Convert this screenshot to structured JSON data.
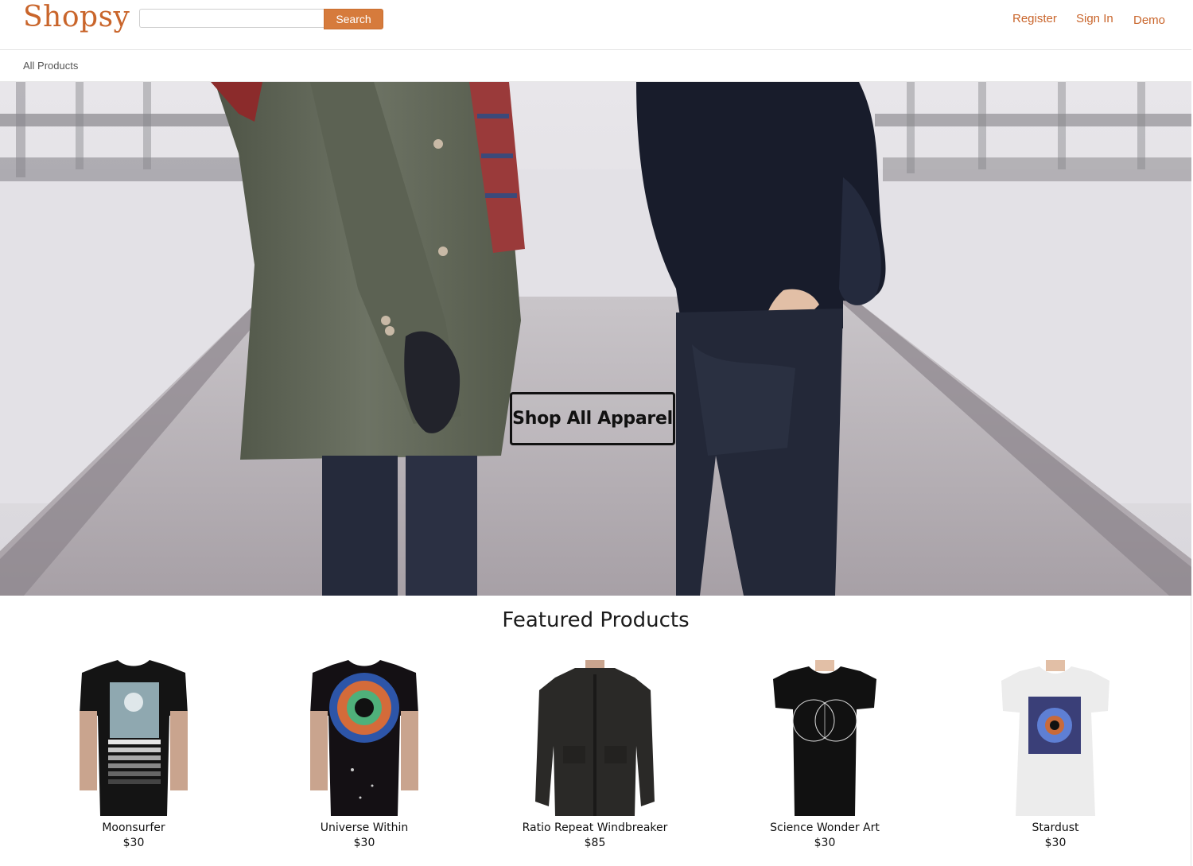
{
  "header": {
    "logo": "Shopsy",
    "search": {
      "placeholder": "",
      "value": "",
      "button_label": "Search"
    },
    "links": {
      "register": "Register",
      "sign_in": "Sign In",
      "demo": "Demo"
    }
  },
  "subnav": {
    "all_products": "All Products"
  },
  "hero": {
    "cta_label": "Shop All Apparel"
  },
  "featured": {
    "title": "Featured Products",
    "products": [
      {
        "name": "Moonsurfer",
        "price": "$30"
      },
      {
        "name": "Universe Within",
        "price": "$30"
      },
      {
        "name": "Ratio Repeat Windbreaker",
        "price": "$85"
      },
      {
        "name": "Science Wonder Art",
        "price": "$30"
      },
      {
        "name": "Stardust",
        "price": "$30"
      }
    ]
  },
  "colors": {
    "brand": "#c9652b",
    "search_button": "#d67b3c"
  }
}
